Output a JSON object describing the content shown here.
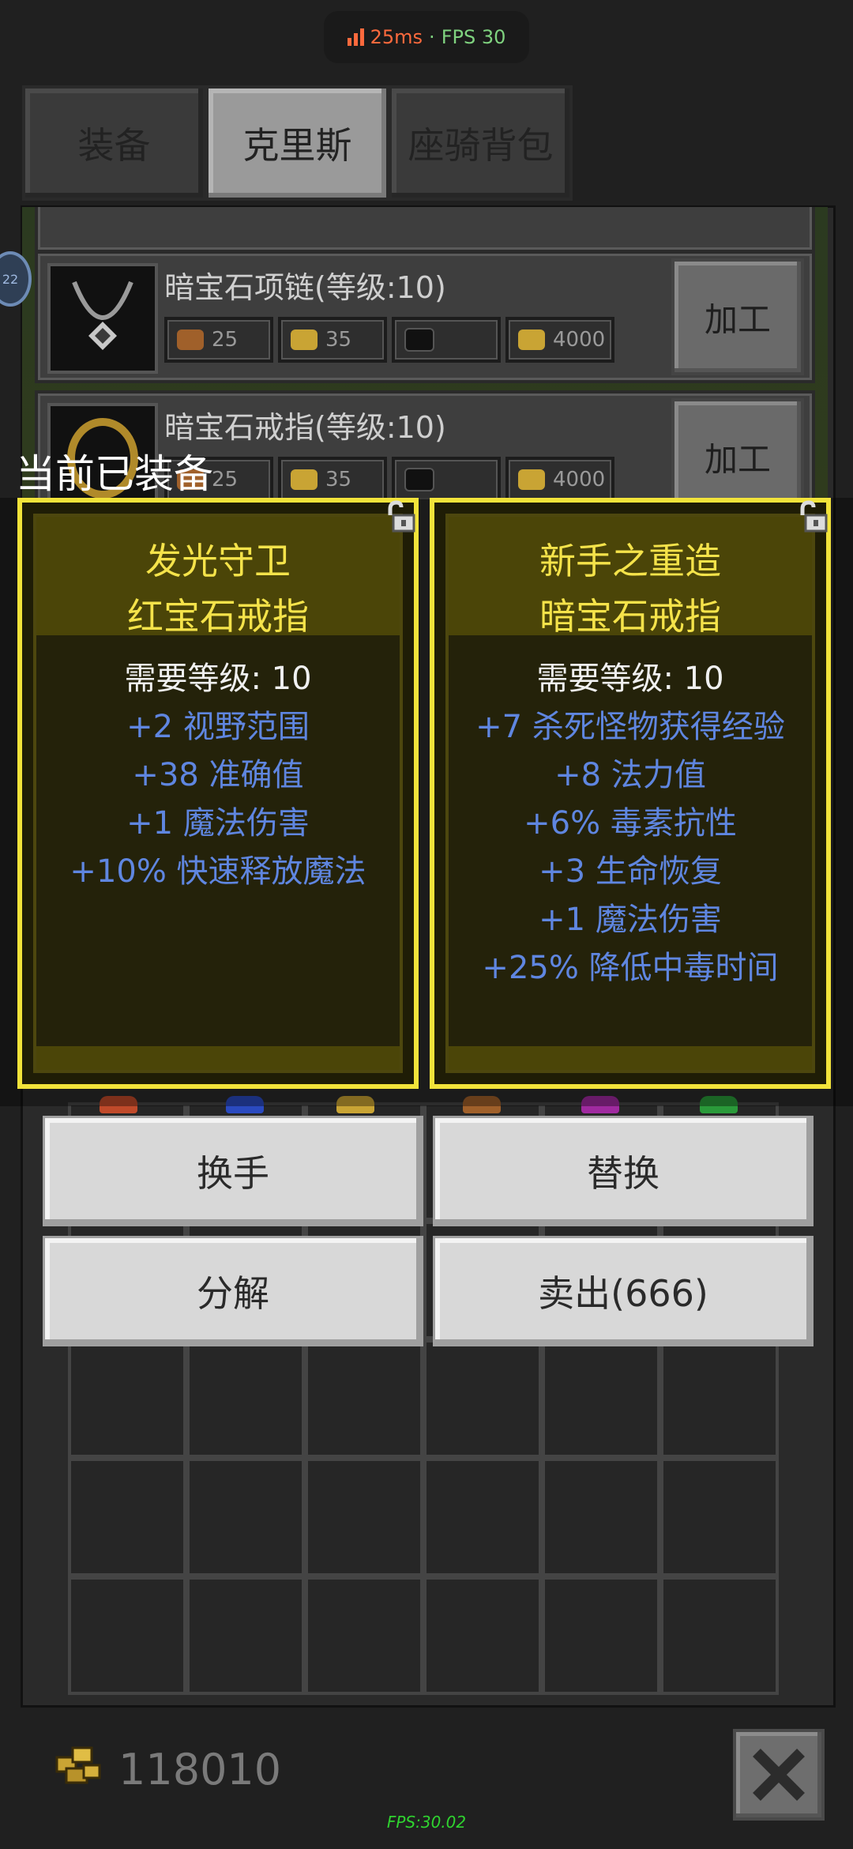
{
  "status": {
    "ping": "25ms",
    "separator": "·",
    "fps": "FPS 30"
  },
  "tabs": [
    {
      "label": "装备",
      "active": false
    },
    {
      "label": "克里斯",
      "active": true
    },
    {
      "label": "座骑背包",
      "active": false
    }
  ],
  "side_badge": "22",
  "craft_list": [
    {
      "title": "暗宝石项链(等级:10)",
      "materials": [
        "25",
        "35",
        "",
        "4000"
      ],
      "action": "加工"
    },
    {
      "title": "暗宝石戒指(等级:10)",
      "materials": [
        "25",
        "35",
        "",
        "4000"
      ],
      "action": "加工"
    }
  ],
  "overlay_title": "当前已装备",
  "cards": [
    {
      "name_line1": "发光守卫",
      "name_line2": "红宝石戒指",
      "requirement": "需要等级: 10",
      "stats": [
        "+2 视野范围",
        "+38 准确值",
        "+1 魔法伤害",
        "+10% 快速释放魔法"
      ]
    },
    {
      "name_line1": "新手之重造",
      "name_line2": "暗宝石戒指",
      "requirement": "需要等级: 10",
      "stats": [
        "+7 杀死怪物获得经验",
        "+8 法力值",
        "+6% 毒素抗性",
        "+3 生命恢复",
        "+1 魔法伤害",
        "+25% 降低中毒时间"
      ]
    }
  ],
  "actions": {
    "swap_hand": "换手",
    "replace": "替换",
    "disassemble": "分解",
    "sell": "卖出(666)"
  },
  "gold": "118010",
  "fps_footer": "FPS:30.02",
  "colors": {
    "card_border": "#f2e33a",
    "item_name": "#f5e34a",
    "stat_text": "#5f86e0",
    "fps_green": "#2fd32f",
    "ping_orange": "#ff6a3d"
  }
}
